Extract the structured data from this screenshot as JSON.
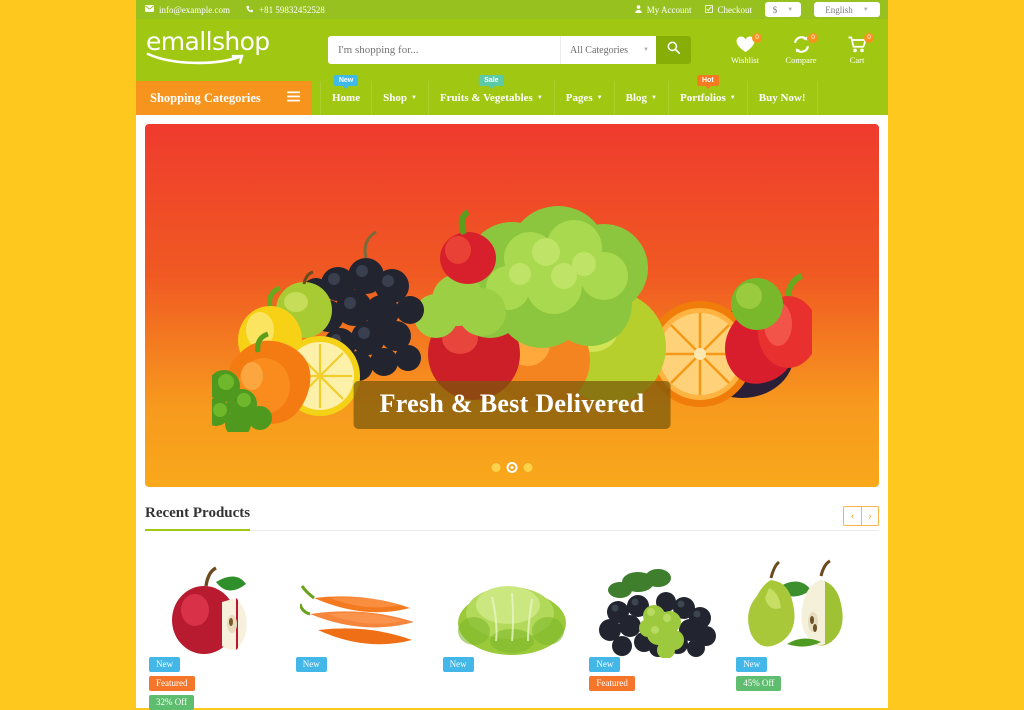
{
  "topbar": {
    "email": "info@example.com",
    "phone": "+81 59832452528",
    "account_label": "My Account",
    "checkout_label": "Checkout",
    "currency": "$",
    "language": "English",
    "mail_icon": "envelope-icon",
    "phone_icon": "phone-icon",
    "user_icon": "user-icon",
    "check_icon": "check-square-icon"
  },
  "header": {
    "logo_text": "emallshop",
    "search_placeholder": "I'm shopping for...",
    "search_value": "",
    "search_category": "All Categories",
    "icons": [
      {
        "name": "wishlist",
        "label": "Wishlist",
        "count": "0"
      },
      {
        "name": "compare",
        "label": "Compare",
        "count": "0"
      },
      {
        "name": "cart",
        "label": "Cart",
        "count": "0"
      }
    ]
  },
  "nav": {
    "categories_label": "Shopping Categories",
    "items": [
      {
        "label": "Home",
        "caret": false,
        "badge": "New",
        "badge_type": "new"
      },
      {
        "label": "Shop",
        "caret": true,
        "badge": "",
        "badge_type": ""
      },
      {
        "label": "Fruits & Vegetables",
        "caret": true,
        "badge": "Sale",
        "badge_type": "sale"
      },
      {
        "label": "Pages",
        "caret": true,
        "badge": "",
        "badge_type": ""
      },
      {
        "label": "Blog",
        "caret": true,
        "badge": "",
        "badge_type": ""
      },
      {
        "label": "Portfolios",
        "caret": true,
        "badge": "Hot",
        "badge_type": "hot"
      },
      {
        "label": "Buy Now!",
        "caret": false,
        "badge": "",
        "badge_type": ""
      }
    ]
  },
  "hero": {
    "caption": "Fresh & Best Delivered",
    "slides_total": 3,
    "active_slide": 2
  },
  "recent": {
    "title": "Recent Products",
    "prev_icon": "chevron-left-icon",
    "next_icon": "chevron-right-icon",
    "products": [
      {
        "image": "red-apple",
        "badges": [
          {
            "text": "New",
            "type": "new"
          },
          {
            "text": "Featured",
            "type": "featured"
          },
          {
            "text": "32% Off",
            "type": "off"
          }
        ]
      },
      {
        "image": "carrots",
        "badges": [
          {
            "text": "New",
            "type": "new"
          }
        ]
      },
      {
        "image": "cabbage",
        "badges": [
          {
            "text": "New",
            "type": "new"
          }
        ]
      },
      {
        "image": "grapes",
        "badges": [
          {
            "text": "New",
            "type": "new"
          },
          {
            "text": "Featured",
            "type": "featured"
          }
        ]
      },
      {
        "image": "pears",
        "badges": [
          {
            "text": "New",
            "type": "new"
          },
          {
            "text": "45% Off",
            "type": "off"
          }
        ]
      }
    ]
  },
  "colors": {
    "page_background": "#ffc81e",
    "header_green": "#a0c813",
    "topbar_green": "#96c11e",
    "orange": "#f7941e",
    "badge_new": "#43b7e8",
    "badge_featured": "#f5762b",
    "badge_off": "#5fbd6f"
  }
}
